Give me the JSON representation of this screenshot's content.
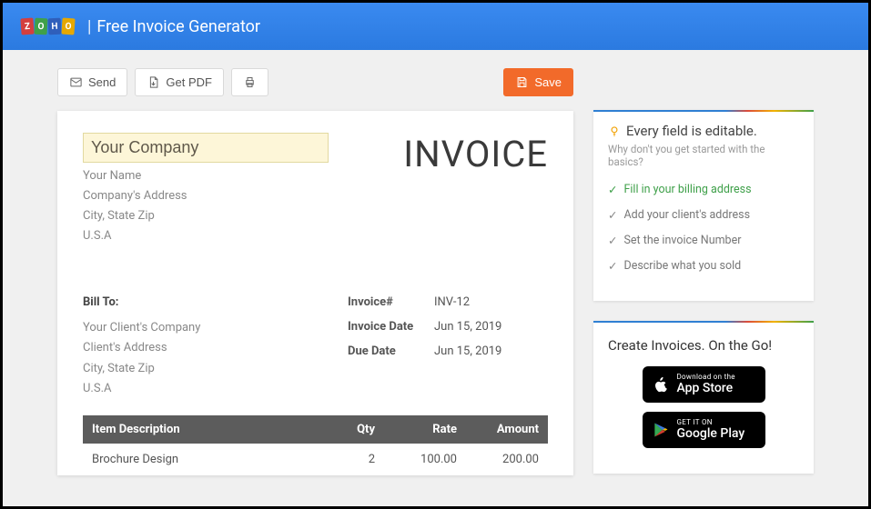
{
  "header": {
    "brand_letters": [
      "Z",
      "O",
      "H",
      "O"
    ],
    "title": "Free Invoice Generator"
  },
  "toolbar": {
    "send": "Send",
    "get_pdf": "Get PDF",
    "save": "Save"
  },
  "invoice": {
    "title": "INVOICE",
    "company": {
      "name_placeholder": "Your Company",
      "your_name": "Your Name",
      "address": "Company's Address",
      "city_zip": "City, State Zip",
      "country": "U.S.A"
    },
    "bill_to_label": "Bill To:",
    "client": {
      "company": "Your Client's Company",
      "address": "Client's Address",
      "city_zip": "City, State Zip",
      "country": "U.S.A"
    },
    "meta": {
      "number_label": "Invoice#",
      "number_value": "INV-12",
      "date_label": "Invoice Date",
      "date_value": "Jun 15, 2019",
      "due_label": "Due Date",
      "due_value": "Jun 15, 2019"
    },
    "columns": {
      "desc": "Item Description",
      "qty": "Qty",
      "rate": "Rate",
      "amount": "Amount"
    },
    "items": [
      {
        "desc": "Brochure Design",
        "qty": "2",
        "rate": "100.00",
        "amount": "200.00"
      }
    ]
  },
  "sidebar": {
    "tips_title": "Every field is editable.",
    "tips_sub": "Why don't you get started with the basics?",
    "tips": [
      "Fill in your billing address",
      "Add your client's address",
      "Set the invoice Number",
      "Describe what you sold"
    ],
    "promo_title": "Create Invoices. On the Go!",
    "appstore_small": "Download on the",
    "appstore_big": "App Store",
    "play_small": "GET IT ON",
    "play_big": "Google Play"
  }
}
